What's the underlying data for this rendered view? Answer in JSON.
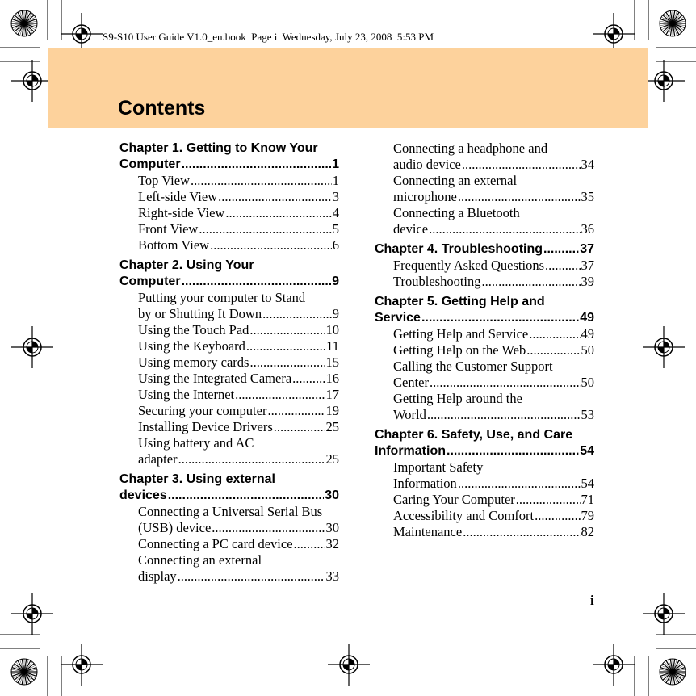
{
  "header": "S9-S10 User Guide V1.0_en.book  Page i  Wednesday, July 23, 2008  5:53 PM",
  "title": "Contents",
  "folio": "i",
  "colors": {
    "band": "#fdd29c"
  },
  "left": [
    {
      "pre": "Chapter 1. Getting to Know Your",
      "text": "Computer",
      "page": "1",
      "entries": [
        {
          "text": "Top View",
          "page": "1"
        },
        {
          "text": "Left-side View",
          "page": "3"
        },
        {
          "text": "Right-side View",
          "page": "4"
        },
        {
          "text": "Front View",
          "page": "5"
        },
        {
          "text": "Bottom View",
          "page": "6"
        }
      ]
    },
    {
      "pre": "Chapter 2. Using Your",
      "text": "Computer",
      "page": "9",
      "entries": [
        {
          "pre": "Putting your computer to Stand",
          "text": "by or Shutting It Down",
          "page": "9"
        },
        {
          "text": "Using the Touch Pad",
          "page": "10"
        },
        {
          "text": "Using the Keyboard",
          "page": "11"
        },
        {
          "text": "Using memory cards",
          "page": "15"
        },
        {
          "text": "Using the Integrated Camera",
          "page": "16"
        },
        {
          "text": "Using the Internet",
          "page": "17"
        },
        {
          "text": "Securing your computer",
          "page": "19"
        },
        {
          "text": "Installing Device Drivers",
          "page": "25"
        },
        {
          "pre": "Using battery and AC",
          "text": "adapter",
          "page": "25"
        }
      ]
    },
    {
      "pre": "Chapter 3. Using external",
      "text": "devices",
      "page": "30",
      "entries": [
        {
          "pre": "Connecting a Universal Serial Bus",
          "text": "(USB) device",
          "page": "30"
        },
        {
          "text": "Connecting a PC card device",
          "page": "32"
        },
        {
          "pre": "Connecting an external",
          "text": "display",
          "page": "33"
        }
      ]
    }
  ],
  "right": [
    {
      "entries": [
        {
          "pre": "Connecting a headphone and",
          "text": "audio device",
          "page": "34"
        },
        {
          "pre": "Connecting an external",
          "text": "microphone",
          "page": "35"
        },
        {
          "pre": "Connecting a Bluetooth",
          "text": "device",
          "page": "36"
        }
      ]
    },
    {
      "text": "Chapter 4. Troubleshooting",
      "page": "37",
      "entries": [
        {
          "text": "Frequently Asked Questions",
          "page": "37"
        },
        {
          "text": "Troubleshooting",
          "page": "39"
        }
      ]
    },
    {
      "pre": "Chapter 5. Getting Help and",
      "text": "Service",
      "page": "49",
      "entries": [
        {
          "text": "Getting Help and Service",
          "page": "49"
        },
        {
          "text": "Getting Help on the Web",
          "page": "50"
        },
        {
          "pre": "Calling the Customer Support",
          "text": "Center",
          "page": "50"
        },
        {
          "pre": "Getting Help around the",
          "text": "World",
          "page": "53"
        }
      ]
    },
    {
      "pre": "Chapter 6. Safety, Use, and Care",
      "text": "Information",
      "page": "54",
      "entries": [
        {
          "pre": "Important Safety",
          "text": "Information",
          "page": "54"
        },
        {
          "text": "Caring Your Computer",
          "page": "71"
        },
        {
          "text": "Accessibility and Comfort",
          "page": "79"
        },
        {
          "text": "Maintenance",
          "page": "82"
        }
      ]
    }
  ]
}
